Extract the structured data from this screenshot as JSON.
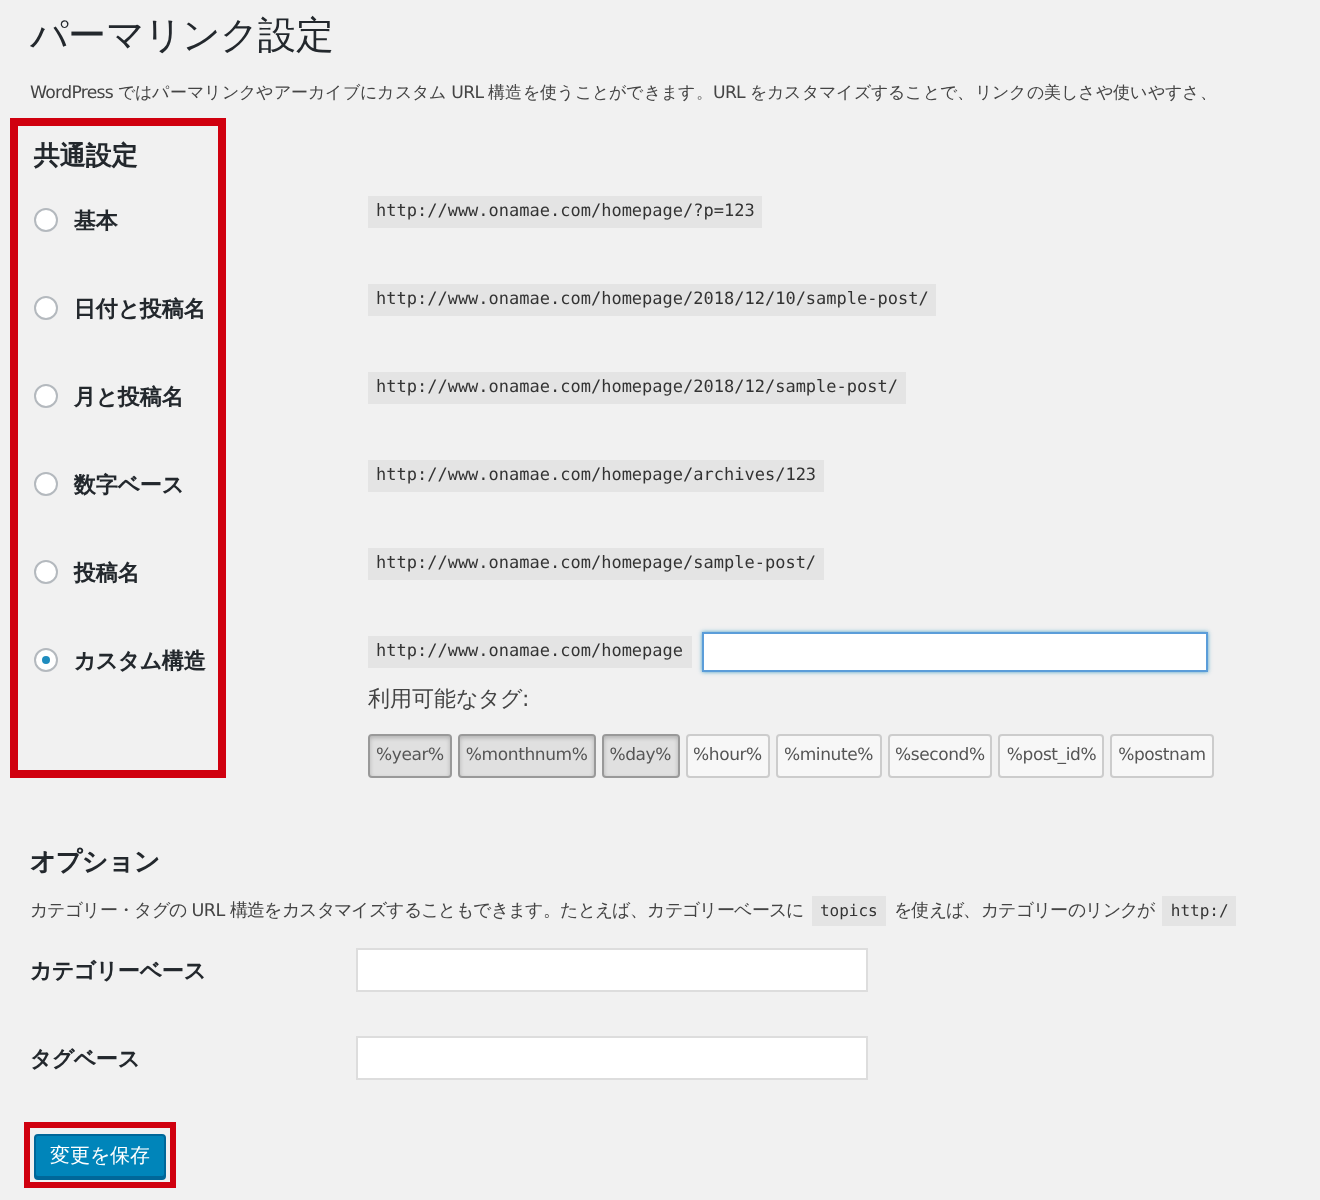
{
  "title": "パーマリンク設定",
  "intro": "WordPress ではパーマリンクやアーカイブにカスタム URL 構造を使うことができます。URL をカスタマイズすることで、リンクの美しさや使いやすさ、",
  "common": {
    "heading": "共通設定",
    "options": [
      {
        "label": "基本",
        "selected": false,
        "example": "http://www.onamae.com/homepage/?p=123"
      },
      {
        "label": "日付と投稿名",
        "selected": false,
        "example": "http://www.onamae.com/homepage/2018/12/10/sample-post/"
      },
      {
        "label": "月と投稿名",
        "selected": false,
        "example": "http://www.onamae.com/homepage/2018/12/sample-post/"
      },
      {
        "label": "数字ベース",
        "selected": false,
        "example": "http://www.onamae.com/homepage/archives/123"
      },
      {
        "label": "投稿名",
        "selected": false,
        "example": "http://www.onamae.com/homepage/sample-post/"
      },
      {
        "label": "カスタム構造",
        "selected": true,
        "example": "http://www.onamae.com/homepage",
        "kind": "custom"
      }
    ],
    "tags_label": "利用可能なタグ:",
    "tags": [
      {
        "label": "%year%",
        "selected": true
      },
      {
        "label": "%monthnum%",
        "selected": true
      },
      {
        "label": "%day%",
        "selected": true
      },
      {
        "label": "%hour%",
        "selected": false
      },
      {
        "label": "%minute%",
        "selected": false
      },
      {
        "label": "%second%",
        "selected": false
      },
      {
        "label": "%post_id%",
        "selected": false
      },
      {
        "label": "%postnam",
        "selected": false
      }
    ]
  },
  "optional": {
    "heading": "オプション",
    "description": [
      {
        "kind": "text",
        "text": "カテゴリー・タグの URL 構造をカスタマイズすることもできます。たとえば、カテゴリーベースに"
      },
      {
        "kind": "code",
        "text": "topics"
      },
      {
        "kind": "text",
        "text": "を使えば、カテゴリーのリンクが"
      },
      {
        "kind": "code",
        "text": "http:/"
      }
    ],
    "fields": [
      {
        "label": "カテゴリーベース"
      },
      {
        "label": "タグベース"
      }
    ]
  },
  "save_button": "変更を保存"
}
